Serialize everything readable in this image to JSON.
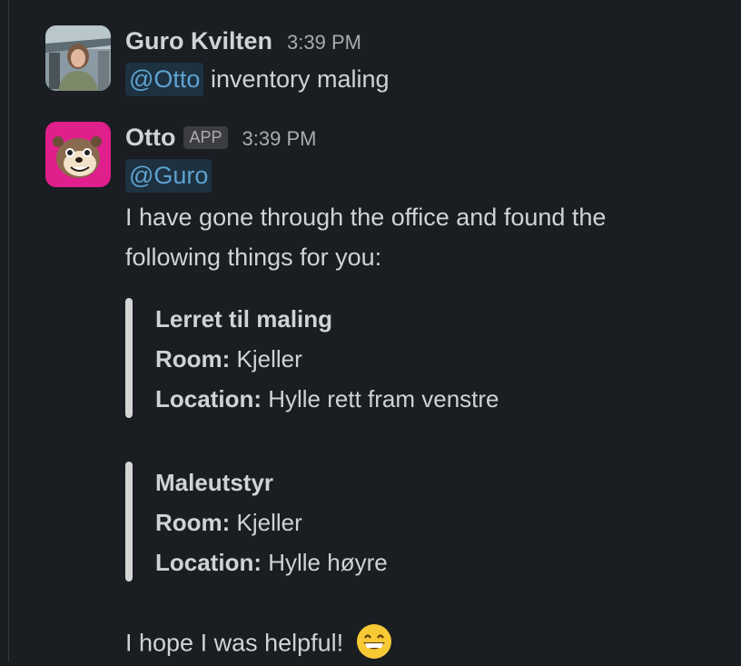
{
  "messages": [
    {
      "author": "Guro Kvilten",
      "time": "3:39 PM",
      "mention": "@Otto",
      "text": " inventory maling"
    },
    {
      "author": "Otto",
      "badge": "APP",
      "time": "3:39 PM",
      "mention": "@Guro",
      "intro_line1": "I have gone through the office and found the",
      "intro_line2": "following things for you:",
      "items": [
        {
          "title": "Lerret til maling",
          "room_label": "Room:",
          "room_value": " Kjeller",
          "location_label": "Location:",
          "location_value": " Hylle rett fram venstre"
        },
        {
          "title": "Maleutstyr",
          "room_label": "Room:",
          "room_value": " Kjeller",
          "location_label": "Location:",
          "location_value": " Hylle høyre"
        }
      ],
      "closing": "I hope I was helpful!",
      "closing_emoji": "grinning-face-emoji"
    }
  ],
  "colors": {
    "background": "#1a1d21",
    "text": "#d1d2d3",
    "mention_bg": "#1d3141",
    "mention_text": "#5ea2cf",
    "otto_avatar_bg": "#e01e8c"
  }
}
